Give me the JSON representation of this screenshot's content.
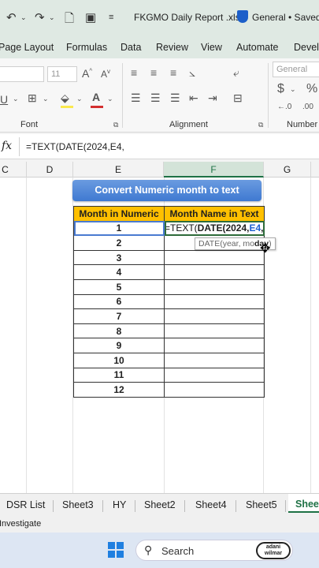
{
  "title_bar": {
    "file_name": "FKGMO Daily Report .xlsx",
    "sensitivity": "General • Saved"
  },
  "ribbon_tabs": [
    "Page Layout",
    "Formulas",
    "Data",
    "Review",
    "View",
    "Automate",
    "Devel"
  ],
  "ribbon": {
    "font_size": "11",
    "number_format": "General",
    "groups": {
      "font": "Font",
      "alignment": "Alignment",
      "number": "Number"
    }
  },
  "formula_bar": {
    "fx": "fx",
    "formula": "=TEXT(DATE(2024,E4,"
  },
  "columns": [
    "C",
    "D",
    "E",
    "F",
    "G"
  ],
  "sheet": {
    "banner": "Convert Numeric month to text",
    "headers": [
      "Month in Numeric",
      "Month Name in Text"
    ],
    "rows": [
      "1",
      "2",
      "3",
      "4",
      "5",
      "6",
      "7",
      "8",
      "9",
      "10",
      "11",
      "12"
    ],
    "editing": {
      "prefix": "=TEXT(",
      "func": "DATE(2024,",
      "ref": "E4",
      "suffix": ","
    },
    "tooltip": "DATE(year, month, day)",
    "tooltip_parts": {
      "before": "DATE(year, mo",
      "bold": "day",
      "after": ")"
    }
  },
  "sheet_tabs": [
    "DSR List",
    "Sheet3",
    "HY",
    "Sheet2",
    "Sheet4",
    "Sheet5"
  ],
  "active_sheet_tab": "Shee",
  "status_bar": {
    "text": "Investigate"
  },
  "taskbar": {
    "search_label": "Search",
    "app_badge": "adani wilmar"
  }
}
